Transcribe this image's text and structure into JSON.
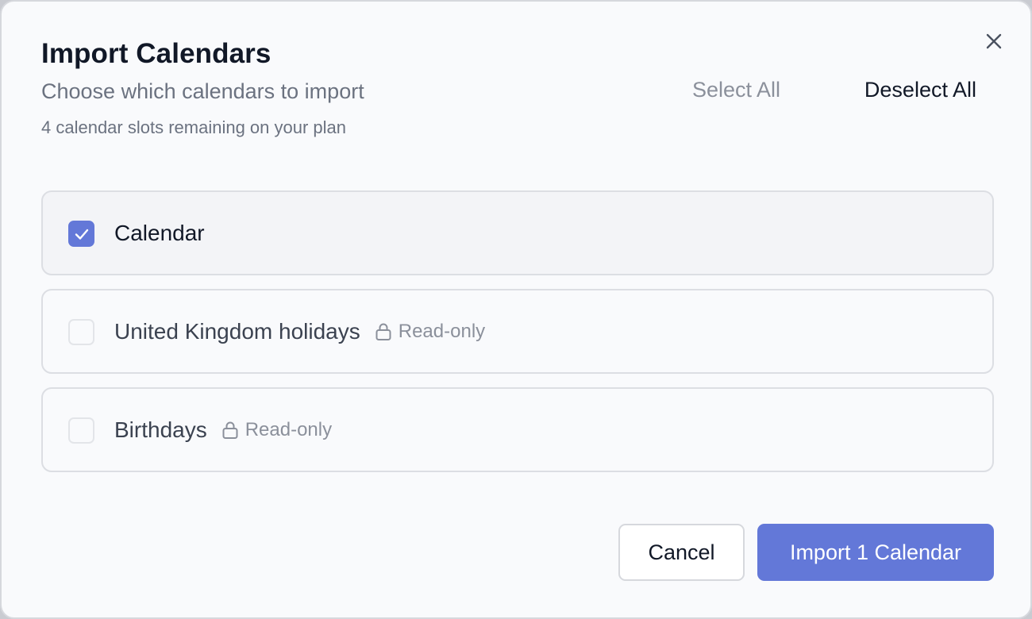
{
  "dialog": {
    "title": "Import Calendars",
    "subtitle": "Choose which calendars to import",
    "quota_text": "4 calendar slots remaining on your plan",
    "select_all_label": "Select All",
    "deselect_all_label": "Deselect All",
    "close_icon": "close-icon"
  },
  "calendars": [
    {
      "name": "Calendar",
      "checked": true,
      "read_only": false,
      "badge": ""
    },
    {
      "name": "United Kingdom holidays",
      "checked": false,
      "read_only": true,
      "badge": "Read-only"
    },
    {
      "name": "Birthdays",
      "checked": false,
      "read_only": true,
      "badge": "Read-only"
    }
  ],
  "footer": {
    "cancel_label": "Cancel",
    "import_label": "Import 1 Calendar"
  },
  "colors": {
    "accent": "#6378d8",
    "text_primary": "#111827",
    "text_muted": "#6b7280",
    "border": "#dcdee3"
  }
}
